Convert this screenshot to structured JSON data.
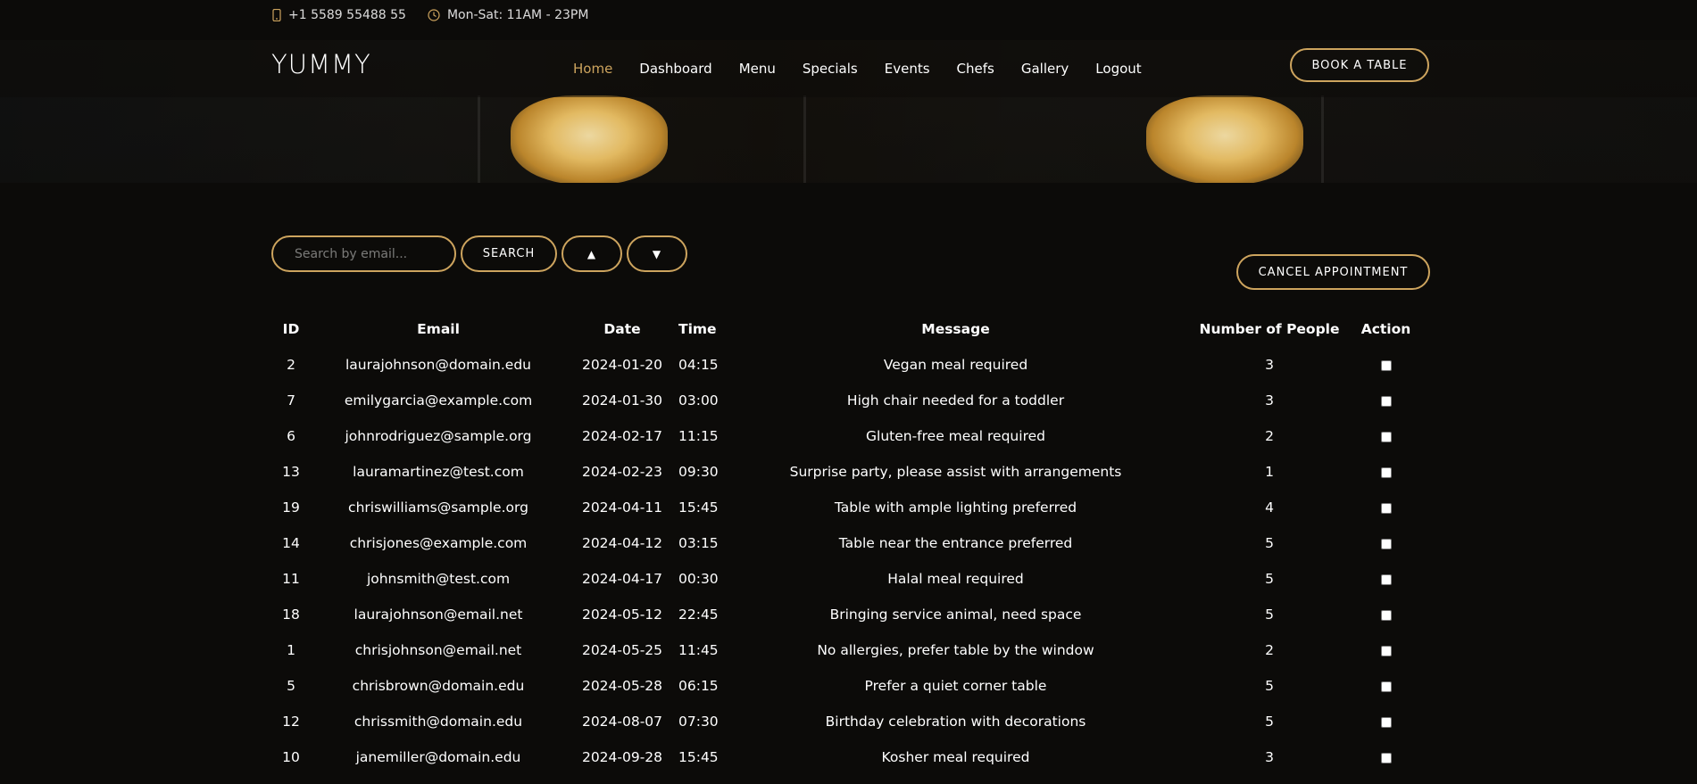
{
  "topbar": {
    "phone": "+1 5589 55488 55",
    "hours": "Mon-Sat: 11AM - 23PM",
    "icons": [
      "phone-icon",
      "clock-icon"
    ]
  },
  "header": {
    "logo": "YUMMY",
    "nav": [
      "Home",
      "Dashboard",
      "Menu",
      "Specials",
      "Events",
      "Chefs",
      "Gallery",
      "Logout"
    ],
    "active_nav": "Home",
    "book_label": "BOOK A TABLE"
  },
  "controls": {
    "search_placeholder": "Search by email...",
    "search_label": "SEARCH",
    "sort_asc_label": "▲",
    "sort_desc_label": "▼",
    "cancel_label": "CANCEL APPOINTMENT"
  },
  "table": {
    "headers": [
      "ID",
      "Email",
      "Date",
      "Time",
      "Message",
      "Number of People",
      "Action"
    ],
    "rows": [
      [
        "2",
        "laurajohnson@domain.edu",
        "2024-01-20",
        "04:15",
        "Vegan meal required",
        "3"
      ],
      [
        "7",
        "emilygarcia@example.com",
        "2024-01-30",
        "03:00",
        "High chair needed for a toddler",
        "3"
      ],
      [
        "6",
        "johnrodriguez@sample.org",
        "2024-02-17",
        "11:15",
        "Gluten-free meal required",
        "2"
      ],
      [
        "13",
        "lauramartinez@test.com",
        "2024-02-23",
        "09:30",
        "Surprise party, please assist with arrangements",
        "1"
      ],
      [
        "19",
        "chriswilliams@sample.org",
        "2024-04-11",
        "15:45",
        "Table with ample lighting preferred",
        "4"
      ],
      [
        "14",
        "chrisjones@example.com",
        "2024-04-12",
        "03:15",
        "Table near the entrance preferred",
        "5"
      ],
      [
        "11",
        "johnsmith@test.com",
        "2024-04-17",
        "00:30",
        "Halal meal required",
        "5"
      ],
      [
        "18",
        "laurajohnson@email.net",
        "2024-05-12",
        "22:45",
        "Bringing service animal, need space",
        "5"
      ],
      [
        "1",
        "chrisjohnson@email.net",
        "2024-05-25",
        "11:45",
        "No allergies, prefer table by the window",
        "2"
      ],
      [
        "5",
        "chrisbrown@domain.edu",
        "2024-05-28",
        "06:15",
        "Prefer a quiet corner table",
        "5"
      ],
      [
        "12",
        "chrissmith@domain.edu",
        "2024-08-07",
        "07:30",
        "Birthday celebration with decorations",
        "5"
      ],
      [
        "10",
        "janemiller@domain.edu",
        "2024-09-28",
        "15:45",
        "Kosher meal required",
        "3"
      ]
    ]
  },
  "colors": {
    "background": "#0c0b09",
    "accent": "#cda45e",
    "text": "#ffffff"
  }
}
